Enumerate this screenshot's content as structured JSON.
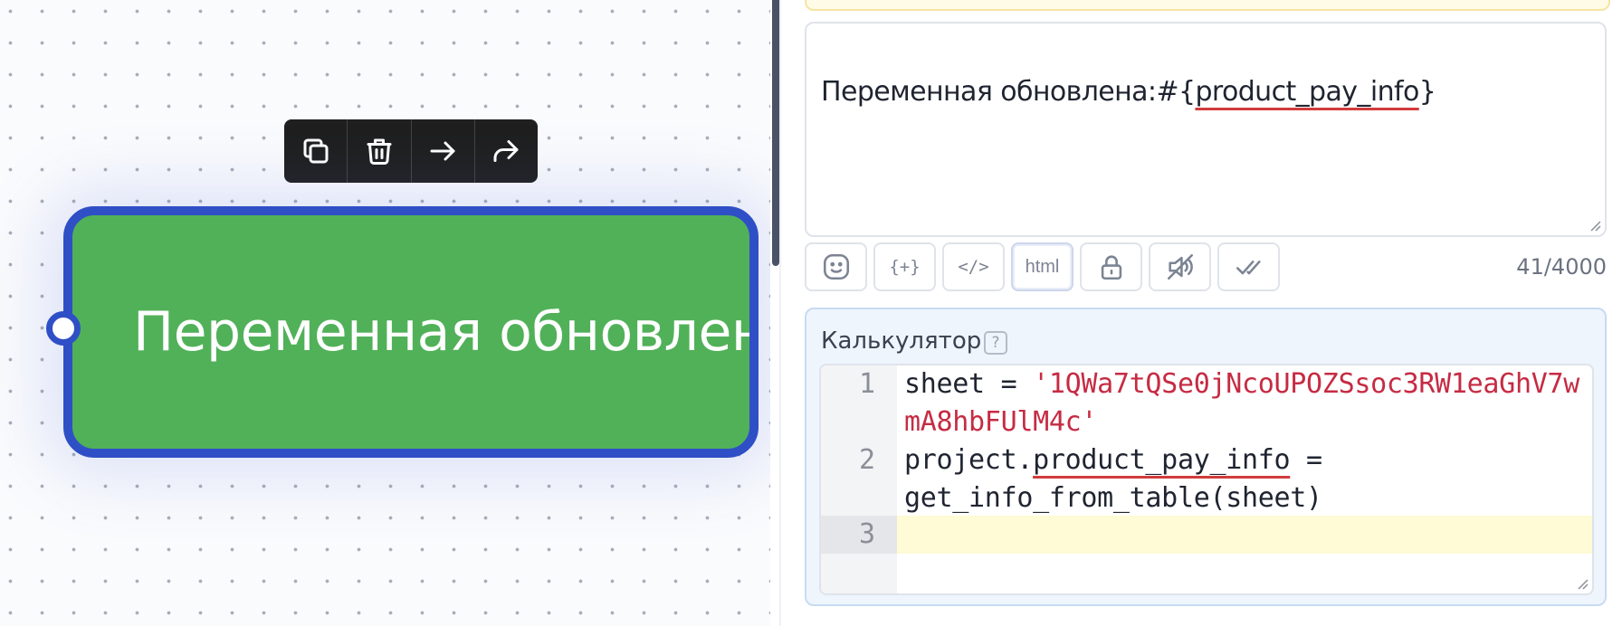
{
  "canvas": {
    "node": {
      "title": "Переменная обновлен"
    },
    "toolbar": {
      "icons": [
        "copy-icon",
        "trash-icon",
        "arrow-right-icon",
        "share-icon"
      ]
    }
  },
  "message": {
    "text_prefix": "Переменная обновлена:#{",
    "variable": "product_pay_info",
    "text_suffix": "}",
    "char_count": "41/4000"
  },
  "format_bar": {
    "buttons": [
      {
        "icon": "emoji-icon"
      },
      {
        "label": "{+}"
      },
      {
        "label": "</>"
      },
      {
        "label": "html"
      },
      {
        "icon": "lock-icon"
      },
      {
        "icon": "sound-off-icon"
      },
      {
        "icon": "double-check-icon"
      }
    ]
  },
  "calculator": {
    "label": "Калькулятор",
    "help": "?",
    "lines": [
      {
        "num": "1",
        "code_prefix": "sheet = ",
        "string_a": "'1QWa7tQSe0jNcoUPOZSsoc3RW1eaGhV7w",
        "string_b": "mA8hbFUlM4c'"
      },
      {
        "num": "2",
        "code_a": "project.",
        "code_var": "product_pay_info",
        "code_b": " =",
        "code_c": "get_info_from_table(sheet)"
      },
      {
        "num": "3"
      }
    ]
  },
  "colors": {
    "node_fill": "#51b159",
    "node_border": "#2f4fc6",
    "string": "#c62b43",
    "spellcheck": "#d23b3b"
  }
}
